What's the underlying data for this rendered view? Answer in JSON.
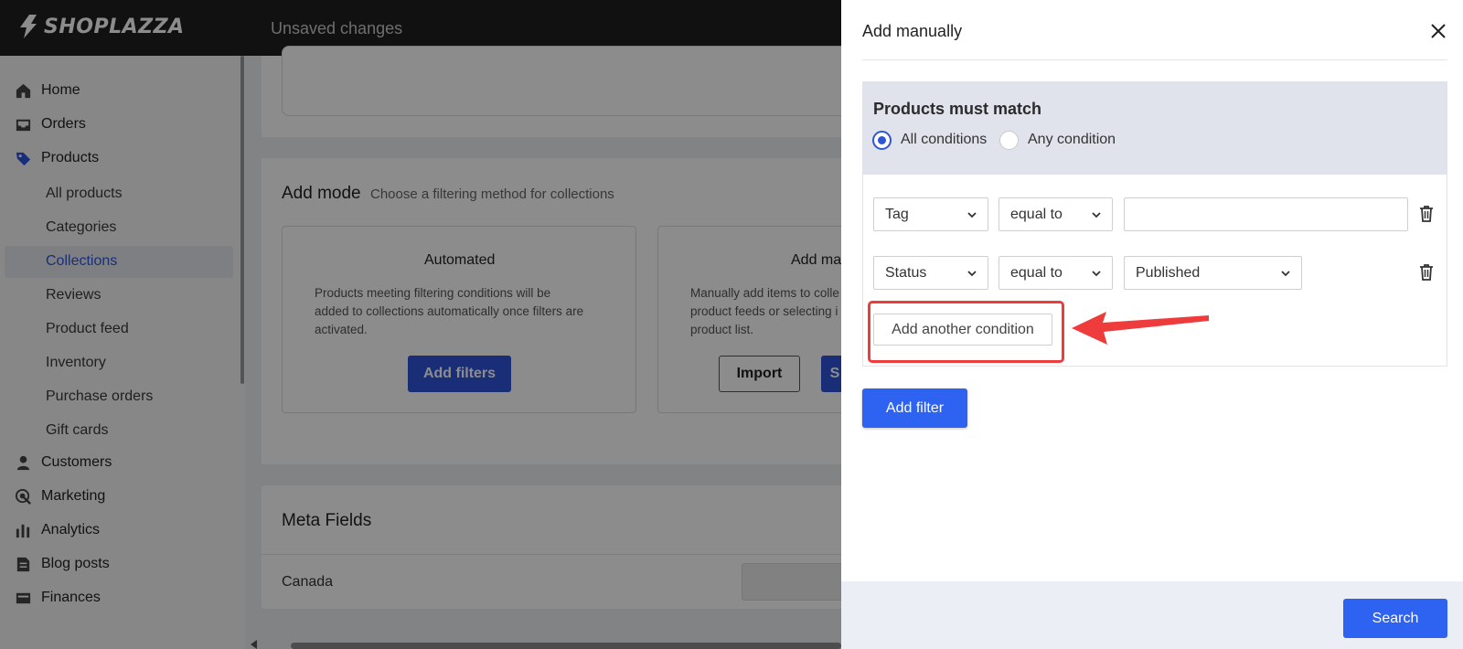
{
  "app": {
    "logo_text": "SHOPLAZZA",
    "status_text": "Unsaved changes"
  },
  "sidebar": {
    "items": [
      {
        "label": "Home",
        "icon": "home-icon"
      },
      {
        "label": "Orders",
        "icon": "inbox-icon"
      },
      {
        "label": "Products",
        "icon": "tag-icon"
      },
      {
        "label": "Customers",
        "icon": "person-icon"
      },
      {
        "label": "Marketing",
        "icon": "target-icon"
      },
      {
        "label": "Analytics",
        "icon": "bar-chart-icon"
      },
      {
        "label": "Blog posts",
        "icon": "document-icon"
      },
      {
        "label": "Finances",
        "icon": "finance-icon"
      }
    ],
    "product_subitems": [
      "All products",
      "Categories",
      "Collections",
      "Reviews",
      "Product feed",
      "Inventory",
      "Purchase orders",
      "Gift cards"
    ],
    "active_subitem": "Collections"
  },
  "main": {
    "add_mode": {
      "title": "Add mode",
      "subtitle": "Choose a filtering method for collections",
      "automated": {
        "title": "Automated",
        "description_lines": [
          "Products meeting filtering conditions will be",
          "added to collections automatically once filters are",
          "activated."
        ],
        "button": "Add filters"
      },
      "manual": {
        "title": "Add ma",
        "description_lines": [
          "Manually add items to colle",
          "product feeds or selecting i",
          "product list."
        ],
        "import_button": "Import",
        "select_button": "S"
      }
    },
    "meta_fields": {
      "title": "Meta Fields",
      "row_label": "Canada"
    }
  },
  "drawer": {
    "title": "Add manually",
    "match": {
      "title": "Products must match",
      "options": [
        "All conditions",
        "Any condition"
      ],
      "selected": "All conditions"
    },
    "conditions": [
      {
        "field": "Tag",
        "operator": "equal to",
        "value": ""
      },
      {
        "field": "Status",
        "operator": "equal to",
        "value": "Published"
      }
    ],
    "add_condition_label": "Add another condition",
    "add_filter_label": "Add filter",
    "search_label": "Search"
  },
  "colors": {
    "accent": "#2e55d9",
    "button_blue": "#2e63f2",
    "annotation_red": "#ee3b3b"
  }
}
